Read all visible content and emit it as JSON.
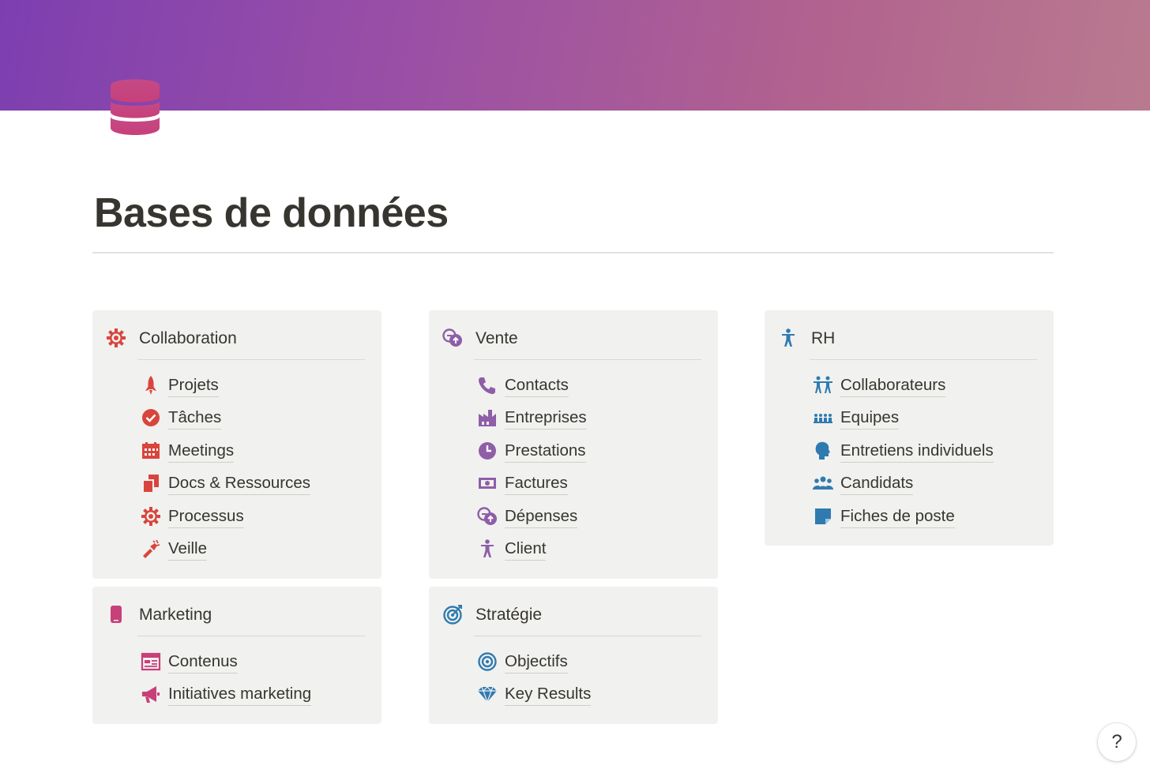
{
  "page": {
    "title": "Bases de données"
  },
  "colors": {
    "red": "#d9453c",
    "purple": "#8e5ea8",
    "blue": "#2f7bb0",
    "pink": "#c8407a"
  },
  "cards": {
    "collaboration": {
      "title": "Collaboration",
      "icon": "gear-icon",
      "items": [
        {
          "label": "Projets",
          "icon": "rocket-icon"
        },
        {
          "label": "Tâches",
          "icon": "check-circle-icon"
        },
        {
          "label": "Meetings",
          "icon": "calendar-icon"
        },
        {
          "label": "Docs & Ressources",
          "icon": "documents-icon"
        },
        {
          "label": "Processus",
          "icon": "gear-icon"
        },
        {
          "label": "Veille",
          "icon": "flashlight-icon"
        }
      ]
    },
    "vente": {
      "title": "Vente",
      "icon": "currency-exchange-icon",
      "items": [
        {
          "label": "Contacts",
          "icon": "phone-icon"
        },
        {
          "label": "Entreprises",
          "icon": "factory-icon"
        },
        {
          "label": "Prestations",
          "icon": "clock-icon"
        },
        {
          "label": "Factures",
          "icon": "banknote-icon"
        },
        {
          "label": "Dépenses",
          "icon": "currency-exchange-icon"
        },
        {
          "label": "Client",
          "icon": "person-icon"
        }
      ]
    },
    "rh": {
      "title": "RH",
      "icon": "person-icon",
      "items": [
        {
          "label": "Collaborateurs",
          "icon": "people-icon"
        },
        {
          "label": "Equipes",
          "icon": "team-icon"
        },
        {
          "label": "Entretiens individuels",
          "icon": "head-icon"
        },
        {
          "label": "Candidats",
          "icon": "group-icon"
        },
        {
          "label": "Fiches de poste",
          "icon": "note-icon"
        }
      ]
    },
    "marketing": {
      "title": "Marketing",
      "icon": "phone-device-icon",
      "items": [
        {
          "label": "Contenus",
          "icon": "layout-icon"
        },
        {
          "label": "Initiatives marketing",
          "icon": "megaphone-icon"
        }
      ]
    },
    "strategie": {
      "title": "Stratégie",
      "icon": "target-icon",
      "items": [
        {
          "label": "Objectifs",
          "icon": "bullseye-icon"
        },
        {
          "label": "Key Results",
          "icon": "diamond-icon"
        }
      ]
    }
  },
  "help": {
    "label": "?"
  }
}
